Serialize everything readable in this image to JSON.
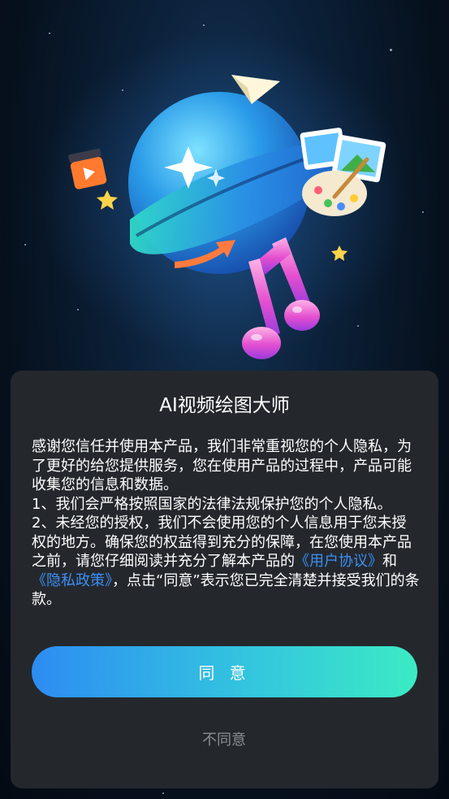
{
  "dialog": {
    "title": "AI视频绘图大师",
    "paragraph1": "感谢您信任并使用本产品，我们非常重视您的个人隐私，为了更好的给您提供服务，您在使用产品的过程中，产品可能收集您的信息和数据。",
    "paragraph2": "1、我们会严格按照国家的法律法规保护您的个人隐私。",
    "paragraph3_start": "2、未经您的授权，我们不会使用您的个人信息用于您未授权的地方。确保您的权益得到充分的保障，在您使用本产品之前，请您仔细阅读并充分了解本产品的",
    "user_agreement_link": "《用户协议》",
    "and_text": "和",
    "privacy_policy_link": "《隐私政策》",
    "paragraph3_end": "，点击“同意”表示您已完全清楚并接受我们的条款。",
    "agree_label": "同 意",
    "decline_label": "不同意"
  },
  "colors": {
    "card_background": "#24282d",
    "link": "#3d8ff5",
    "agree_gradient_start": "#2d8cf2",
    "agree_gradient_end": "#3bebc4",
    "decline_text": "#8a8e93"
  },
  "icons": {
    "hero": "planet-illustration",
    "items": [
      "paper-plane-icon",
      "video-clapper-icon",
      "star-icon",
      "picture-palette-icon",
      "music-note-icon",
      "arrow-icon"
    ]
  }
}
